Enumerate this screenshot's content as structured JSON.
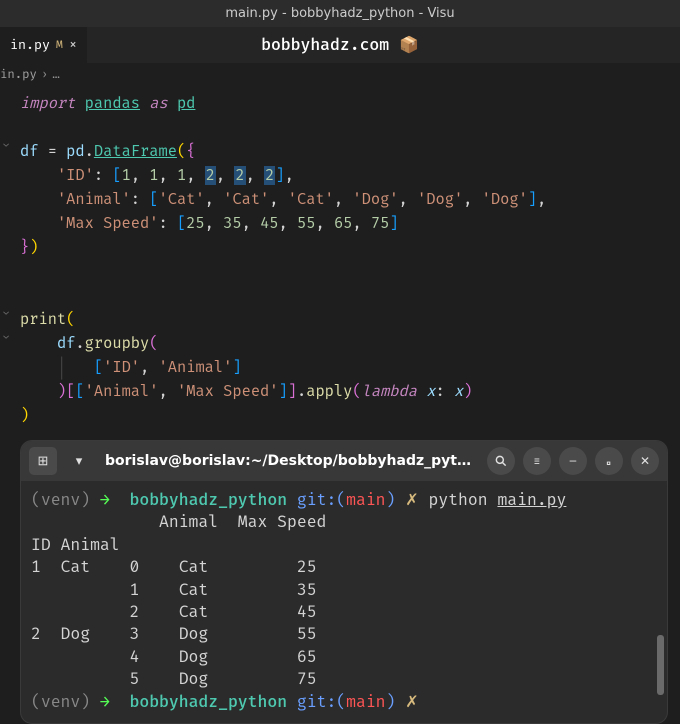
{
  "titlebar": {
    "text": "main.py - bobbyhadz_python - Visu"
  },
  "tab": {
    "filename": "in.py",
    "dirty_marker": "M"
  },
  "overlay": {
    "label": "bobbyhadz.com",
    "emoji": "📦"
  },
  "breadcrumb": {
    "file": "in.py",
    "sep": "›",
    "dots": "…"
  },
  "code": {
    "import_kw": "import",
    "pandas": "pandas",
    "as_kw": "as",
    "pd": "pd",
    "df": "df",
    "eq": "=",
    "DataFrame": "DataFrame",
    "id_key": "'ID'",
    "animal_key": "'Animal'",
    "maxspeed_key": "'Max Speed'",
    "id_vals": [
      "1",
      "1",
      "1",
      "2",
      "2",
      "2"
    ],
    "animal_vals": [
      "'Cat'",
      "'Cat'",
      "'Cat'",
      "'Dog'",
      "'Dog'",
      "'Dog'"
    ],
    "speed_vals": [
      "25",
      "35",
      "45",
      "55",
      "65",
      "75"
    ],
    "print": "print",
    "groupby": "groupby",
    "apply": "apply",
    "lambda": "lambda",
    "x": "x"
  },
  "terminal": {
    "title": "borislav@borislav:~/Desktop/bobbyhadz_pyt…",
    "prompt_venv": "(venv)",
    "prompt_arrow": "→",
    "prompt_dir": "bobbyhadz_python",
    "prompt_git": "git:(",
    "prompt_branch": "main",
    "prompt_gitend": ")",
    "prompt_x": "✗",
    "cmd": "python",
    "cmd_arg": "main.py",
    "header": "             Animal  Max Speed",
    "subheader": "ID Animal",
    "rows": [
      "1  Cat    0    Cat         25",
      "          1    Cat         35",
      "          2    Cat         45",
      "2  Dog    3    Dog         55",
      "          4    Dog         65",
      "          5    Dog         75"
    ]
  },
  "icons": {
    "close_x": "×",
    "new_tab": "⊞",
    "dropdown": "▾",
    "search": "🔍",
    "menu": "≡",
    "min": "–",
    "max": "▫",
    "close": "✕"
  }
}
